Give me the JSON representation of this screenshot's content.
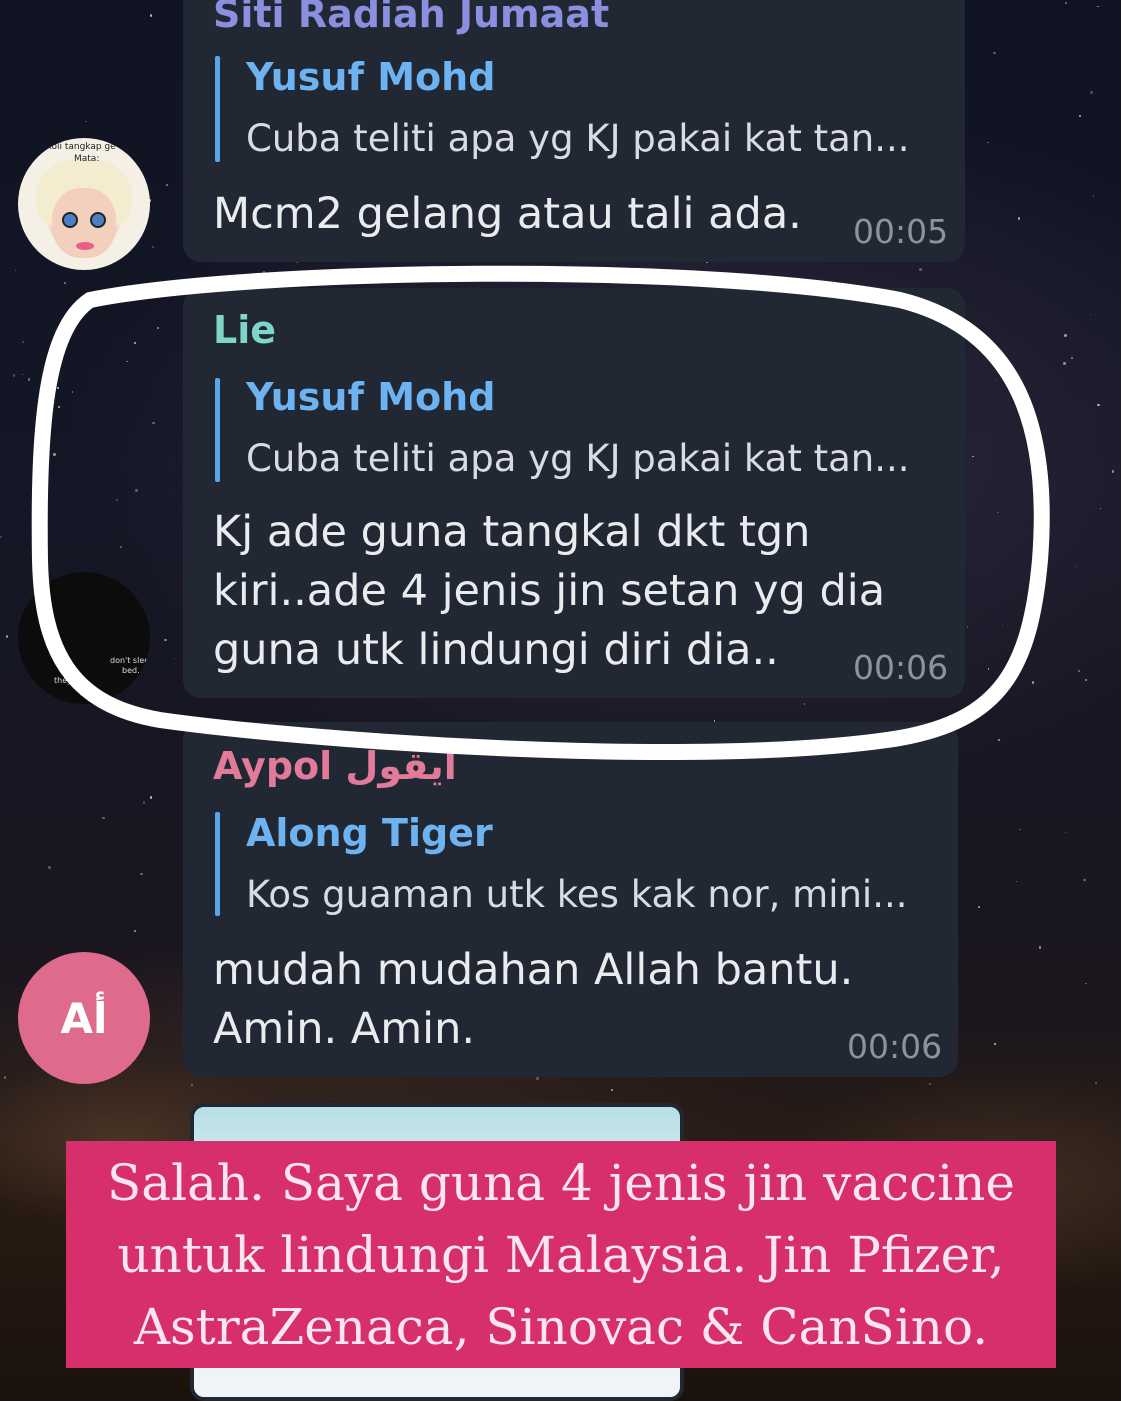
{
  "messages": [
    {
      "sender": "Siti Radiah Jumaat",
      "reply_name": "Yusuf Mohd",
      "reply_text": "Cuba teliti apa yg KJ pakai kat tan...",
      "lines": [
        "Mcm2 gelang atau tali ada."
      ],
      "time": "00:05"
    },
    {
      "sender": "Lie",
      "reply_name": "Yusuf Mohd",
      "reply_text": "Cuba teliti apa yg KJ pakai kat tan...",
      "lines": [
        "Kj ade guna tangkal dkt tgn",
        "kiri..ade 4 jenis jin setan yg dia",
        "guna utk lindungi diri dia.."
      ],
      "time": "00:06"
    },
    {
      "sender": "Aypol ايقول",
      "reply_name": "Along Tiger",
      "reply_text": "Kos guaman utk kes kak nor, mini...",
      "lines": [
        "mudah mudahan Allah bantu.",
        "Amin. Amin."
      ],
      "time": "00:06"
    }
  ],
  "avatars": {
    "doll_tag_1": "p koli tangkap ge",
    "doll_tag_2": "Mata:",
    "dark_tag_1": "don't sleep",
    "dark_tag_2": "bed.",
    "dark_tag_3": "they",
    "initials": "Aأ"
  },
  "caption": {
    "lines": [
      "Salah. Saya guna 4 jenis jin vaccine",
      "untuk lindungi Malaysia. Jin Pfizer,",
      "AstraZenaca, Sinovac & CanSino."
    ]
  },
  "colors": {
    "bubble": "#222833",
    "sender_1": "#8b8fe0",
    "sender_2": "#7fd6c8",
    "sender_3": "#e27a9a",
    "reply_accent": "#6db3f2",
    "caption_bg": "#d62f6c",
    "avatar_al": "#de6a8c"
  }
}
